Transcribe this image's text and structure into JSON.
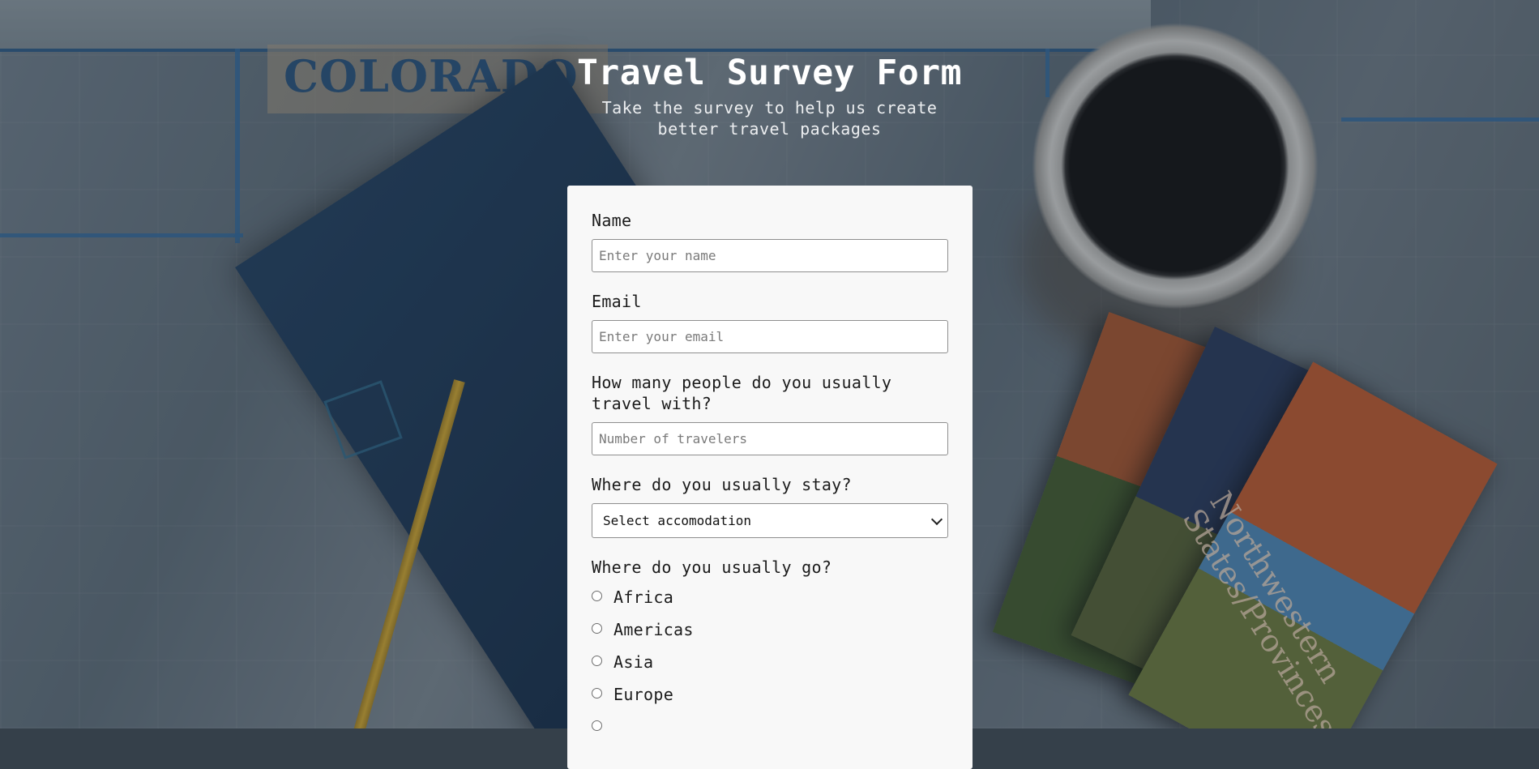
{
  "header": {
    "title": "Travel Survey Form",
    "subtitle": "Take the survey to help us create better travel packages"
  },
  "background": {
    "map_text": "COLORADO",
    "brochure_text": "Northwestern States/Provinces"
  },
  "form": {
    "name": {
      "label": "Name",
      "placeholder": "Enter your name",
      "value": ""
    },
    "email": {
      "label": "Email",
      "placeholder": "Enter your email",
      "value": ""
    },
    "travelers": {
      "label": "How many people do you usually travel with?",
      "placeholder": "Number of travelers",
      "value": ""
    },
    "accommodation": {
      "label": "Where do you usually stay?",
      "selected": "Select accomodation"
    },
    "destination": {
      "label": "Where do you usually go?",
      "options": [
        "Africa",
        "Americas",
        "Asia",
        "Europe"
      ]
    }
  }
}
